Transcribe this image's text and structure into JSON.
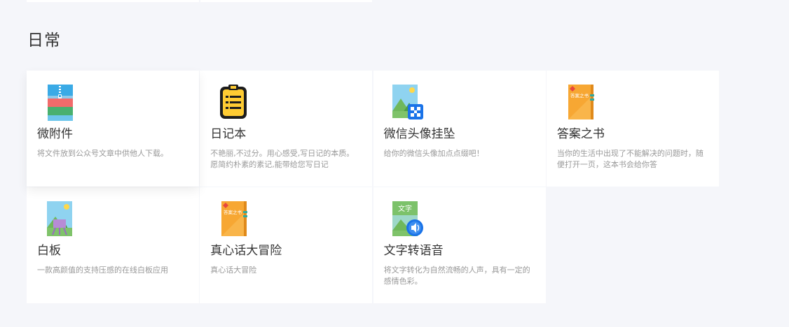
{
  "section": {
    "title": "日常"
  },
  "cards": [
    {
      "title": "微附件",
      "desc": "将文件放到公众号文章中供他人下载。",
      "icon": "zip-archive-icon"
    },
    {
      "title": "日记本",
      "desc": "不艳丽,不过分。用心感受,写日记的本质。愿简约朴素的素记,能带给您写日记",
      "icon": "notebook-icon"
    },
    {
      "title": "微信头像挂坠",
      "desc": "给你的微信头像加点点缀吧！",
      "icon": "avatar-pendant-icon"
    },
    {
      "title": "答案之书",
      "desc": "当你的生活中出现了不能解决的问题时，随便打开一页，这本书会给你答",
      "icon": "answer-book-icon",
      "book_label": "答案之书"
    },
    {
      "title": "白板",
      "desc": "一款高颜值的支持压感的在线白板应用",
      "icon": "whiteboard-icon"
    },
    {
      "title": "真心话大冒险",
      "desc": "真心话大冒险",
      "icon": "truth-or-dare-book-icon",
      "book_label": "答案之书"
    },
    {
      "title": "文字转语音",
      "desc": "将文字转化为自然流畅的人声，具有一定的感情色彩。",
      "icon": "text-to-speech-icon",
      "badge": "文字"
    }
  ],
  "colors": {
    "background": "#f5f6fa",
    "card": "#ffffff",
    "title": "#333333",
    "desc": "#999999",
    "accent_blue": "#1a73e8",
    "book_orange": "#f7a733"
  }
}
